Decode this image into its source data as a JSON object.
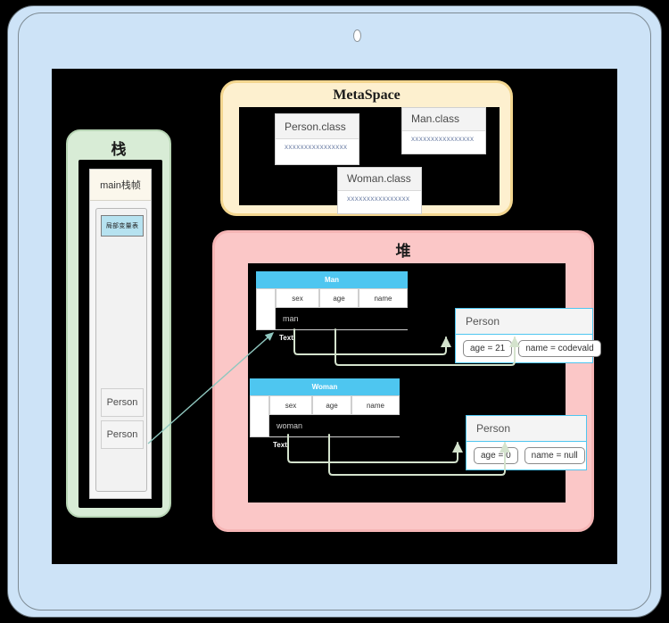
{
  "device": {
    "camera_icon": "camera-dot"
  },
  "regions": {
    "stack": {
      "title": "栈",
      "frame_label": "main栈帧",
      "local_var_table": "局部变量表",
      "slots": [
        "Person",
        "Person"
      ]
    },
    "metaspace": {
      "title": "MetaSpace",
      "classes": [
        {
          "name": "Person.class",
          "body": "xxxxxxxxxxxxxxxx"
        },
        {
          "name": "Man.class",
          "body": "xxxxxxxxxxxxxxxx"
        },
        {
          "name": "Woman.class",
          "body": "xxxxxxxxxxxxxxxx"
        }
      ]
    },
    "heap": {
      "title": "堆",
      "objects": [
        {
          "class_name": "Man",
          "columns": [
            "sex",
            "age",
            "name"
          ],
          "row": [
            "man",
            "",
            ""
          ],
          "caption": "Text"
        },
        {
          "class_name": "Woman",
          "columns": [
            "sex",
            "age",
            "name"
          ],
          "row": [
            "woman",
            "",
            ""
          ],
          "caption": "Text"
        }
      ],
      "person_cards": [
        {
          "title": "Person",
          "fields": [
            "age = 21",
            "name = codevald"
          ]
        },
        {
          "title": "Person",
          "fields": [
            "age = 0",
            "name = null"
          ]
        }
      ]
    }
  },
  "colors": {
    "screen_bg": "#000000",
    "device_bg": "#cde3f7",
    "stack_bg": "#d8ecd6",
    "metaspace_bg": "#fdf0cf",
    "heap_bg": "#fbc7c7",
    "table_header": "#4ec6f0",
    "connector": "#d4e3cd",
    "stack_arrow": "#8fc7bf",
    "local_var_bg": "#b6e2f0"
  }
}
